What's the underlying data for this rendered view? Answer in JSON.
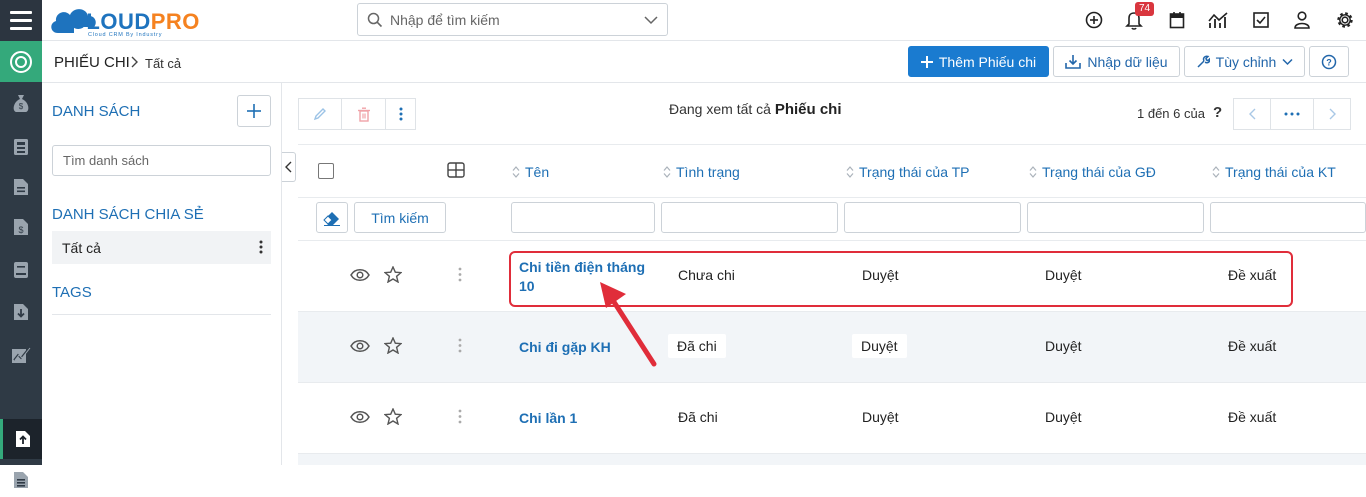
{
  "app": {
    "logo_main": "CLOUD",
    "logo_accent": "PRO",
    "logo_tagline": "Cloud CRM By Industry"
  },
  "topbar": {
    "search_placeholder": "Nhập để tìm kiếm",
    "notification_count": "74",
    "icons": [
      "plus-circle-icon",
      "bell-icon",
      "calendar-icon",
      "chart-icon",
      "checkbox-icon",
      "user-icon",
      "gear-icon"
    ]
  },
  "rail": {
    "items": [
      "money-bag-icon",
      "building-icon",
      "document-icon",
      "invoice-icon",
      "book-icon",
      "download-doc-icon",
      "report-icon",
      "upload-doc-icon",
      "list-doc-icon"
    ],
    "active_index": 7
  },
  "header": {
    "module": "PHIẾU CHI",
    "view": "Tất cả",
    "add_button": "Thêm Phiếu chi",
    "import_button": "Nhập dữ liệu",
    "customize_button": "Tùy chỉnh"
  },
  "sidebar": {
    "list_title": "DANH SÁCH",
    "search_placeholder": "Tìm danh sách",
    "shared_title": "DANH SÁCH CHIA SẺ",
    "shared_item": "Tất cả",
    "tags_title": "TAGS"
  },
  "list": {
    "viewing_prefix": "Đang xem tất cả",
    "viewing_module": "Phiếu chi",
    "paging": "1 đến 6 của",
    "paging_help": "?",
    "columns": [
      "Tên",
      "Tình trạng",
      "Trạng thái của TP",
      "Trạng thái của GĐ",
      "Trạng thái của KT"
    ],
    "search_button": "Tìm kiếm",
    "rows": [
      {
        "name_line1": "Chi tiền điện tháng",
        "name_line2": "10",
        "status": "Chưa chi",
        "tp": "Duyệt",
        "gd": "Duyệt",
        "kt": "Đề xuất"
      },
      {
        "name_line1": "Chi đi gặp KH",
        "name_line2": "",
        "status": "Đã chi",
        "tp": "Duyệt",
        "gd": "Duyệt",
        "kt": "Đề xuất"
      },
      {
        "name_line1": "Chi lần 1",
        "name_line2": "",
        "status": "Đã chi",
        "tp": "Duyệt",
        "gd": "Duyệt",
        "kt": "Đề xuất"
      }
    ]
  },
  "colors": {
    "accent_blue": "#1a7bd0",
    "link_blue": "#1e6fb4",
    "rail_dark": "#2f3a45",
    "home_green": "#34a97b",
    "annotation_red": "#e02d3a",
    "logo_orange": "#f58220"
  }
}
